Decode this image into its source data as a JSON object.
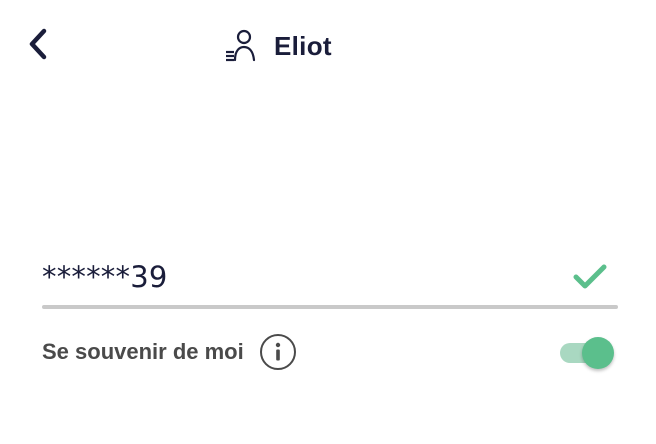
{
  "header": {
    "back_icon": "chevron-left-icon",
    "user_icon": "user-list-icon",
    "title": "Eliot"
  },
  "login_field": {
    "value": "******39",
    "status_icon": "check-icon",
    "status_color": "#5bbf8c"
  },
  "remember_me": {
    "label": "Se souvenir de moi",
    "info_icon": "info-icon",
    "enabled": true,
    "accent_color": "#5bbf8c"
  }
}
